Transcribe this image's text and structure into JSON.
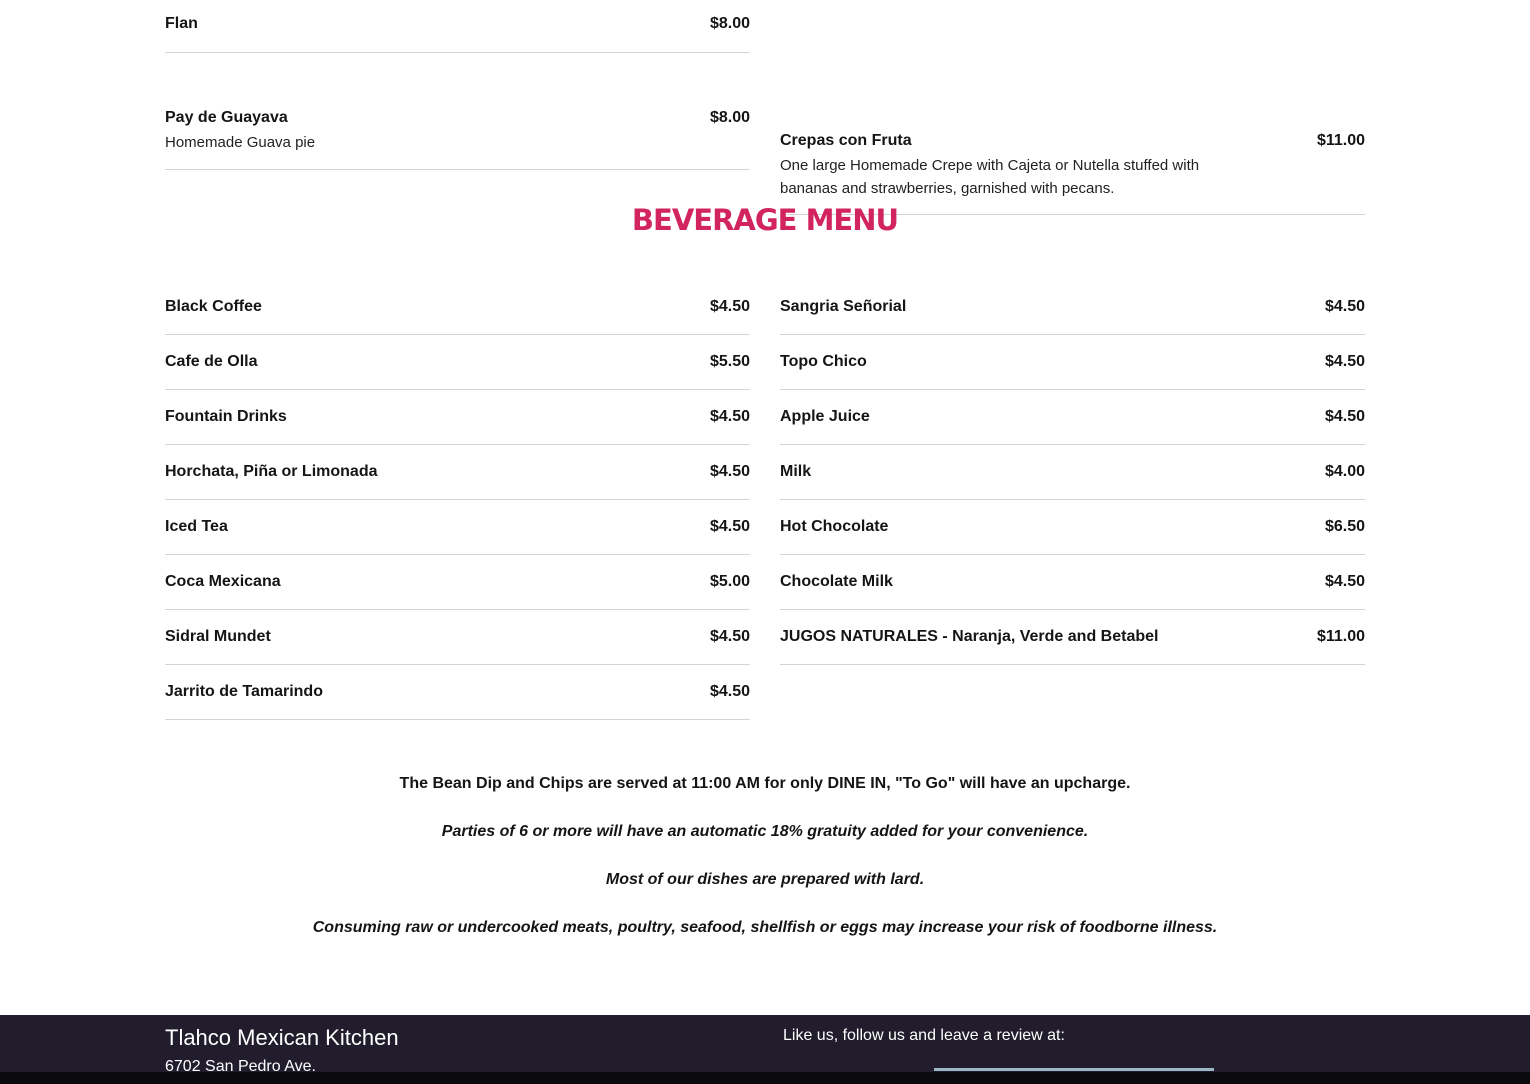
{
  "desserts": {
    "left": [
      {
        "name": "Flan",
        "price": "$8.00",
        "description": ""
      },
      {
        "name": "Pay de Guayava",
        "price": "$8.00",
        "description": "Homemade Guava pie"
      }
    ],
    "right": [
      {
        "name": "Crepas con Fruta",
        "price": "$11.00",
        "description": "One large Homemade Crepe with Cajeta or Nutella stuffed with bananas and strawberries, garnished with pecans."
      }
    ]
  },
  "beverage_menu": {
    "title": "BEVERAGE MENU",
    "accent_color": "#d2245f",
    "left": [
      {
        "name": "Black Coffee",
        "price": "$4.50"
      },
      {
        "name": "Cafe de Olla",
        "price": "$5.50"
      },
      {
        "name": "Fountain Drinks",
        "price": "$4.50"
      },
      {
        "name": "Horchata, Piña or Limonada",
        "price": "$4.50"
      },
      {
        "name": "Iced Tea",
        "price": "$4.50"
      },
      {
        "name": "Coca Mexicana",
        "price": "$5.00"
      },
      {
        "name": "Sidral Mundet",
        "price": "$4.50"
      },
      {
        "name": "Jarrito de Tamarindo",
        "price": "$4.50"
      }
    ],
    "right": [
      {
        "name": "Sangria Señorial",
        "price": "$4.50"
      },
      {
        "name": "Topo Chico",
        "price": "$4.50"
      },
      {
        "name": "Apple Juice",
        "price": "$4.50"
      },
      {
        "name": "Milk",
        "price": "$4.00"
      },
      {
        "name": "Hot Chocolate",
        "price": "$6.50"
      },
      {
        "name": "Chocolate Milk",
        "price": "$4.50"
      },
      {
        "name": "JUGOS NATURALES - Naranja, Verde and Betabel",
        "price": "$11.00"
      }
    ]
  },
  "notes": {
    "bean_dip": "The Bean Dip and Chips are served at 11:00 AM for only DINE IN, \"To Go\" will have an upcharge.",
    "gratuity": "Parties of 6 or more will have an automatic 18% gratuity added for your convenience.",
    "lard": "Most of our dishes are prepared with lard.",
    "raw_warning": "Consuming raw or undercooked meats, poultry, seafood, shellfish or eggs may increase your risk of foodborne illness."
  },
  "footer": {
    "restaurant_name": "Tlahco Mexican Kitchen",
    "address": "6702 San Pedro Ave.",
    "follow_text": "Like us, follow us and leave a review at:",
    "background_color": "#211d2d"
  }
}
